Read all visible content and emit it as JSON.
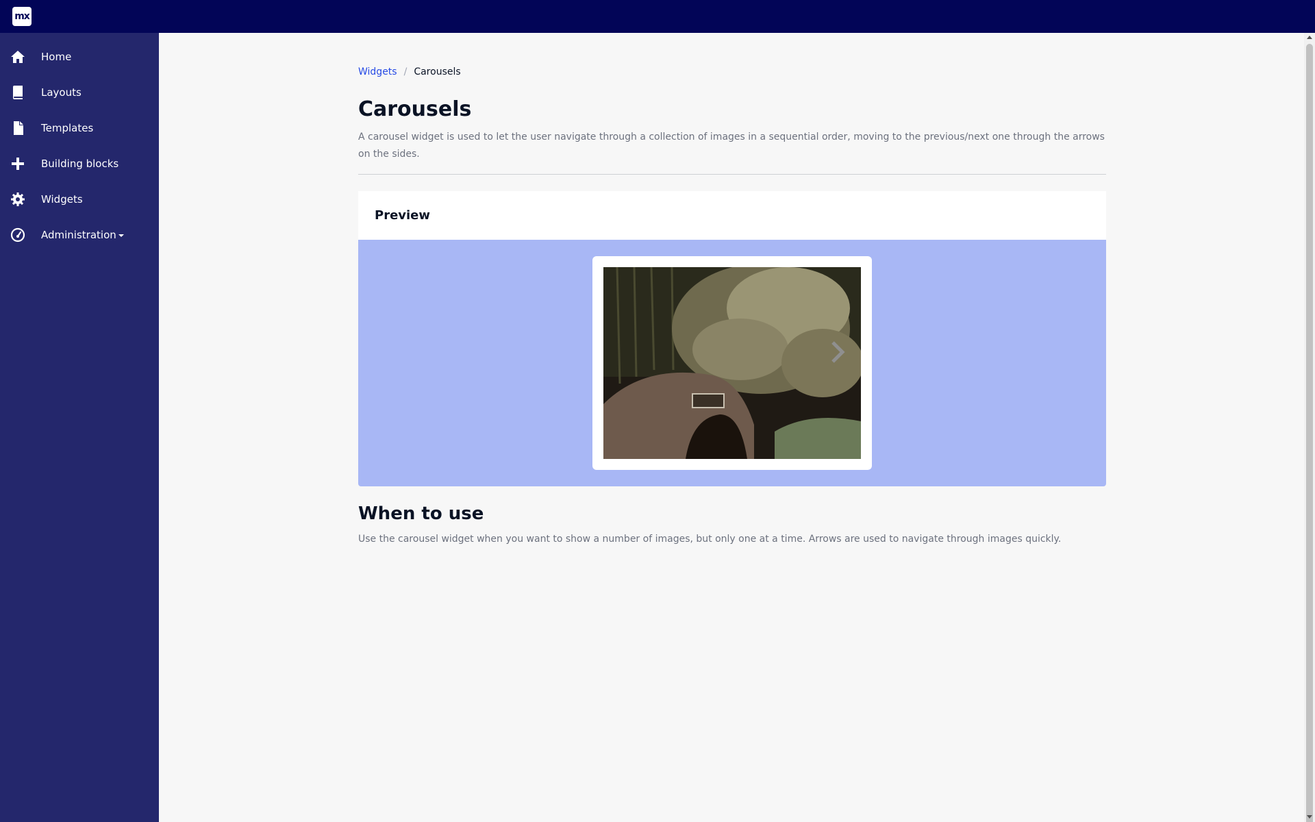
{
  "app": {
    "logo_text": "mx",
    "colors": {
      "topbar": "#020557",
      "sidebar": "#24276c",
      "link": "#264ae5",
      "preview_background": "#a8b7f5"
    }
  },
  "sidebar": {
    "items": [
      {
        "label": "Home",
        "icon": "home-icon"
      },
      {
        "label": "Layouts",
        "icon": "book-icon"
      },
      {
        "label": "Templates",
        "icon": "file-icon"
      },
      {
        "label": "Building blocks",
        "icon": "plus-icon"
      },
      {
        "label": "Widgets",
        "icon": "gear-icon"
      },
      {
        "label": "Administration",
        "icon": "dashboard-icon",
        "has_dropdown": true
      }
    ]
  },
  "breadcrumb": {
    "parent": "Widgets",
    "separator": "/",
    "current": "Carousels"
  },
  "page": {
    "title": "Carousels",
    "description": "A carousel widget is used to let the user navigate through a collection of images in a sequential order, moving to the previous/next one through the arrows on the sides."
  },
  "preview": {
    "title": "Preview",
    "image": "bamboo-and-stone-bridge-photo",
    "next_icon": "chevron-right-icon"
  },
  "when_to_use": {
    "title": "When to use",
    "text": "Use the carousel widget when you want to show a number of images, but only one at a time. Arrows are used to navigate through images quickly."
  }
}
